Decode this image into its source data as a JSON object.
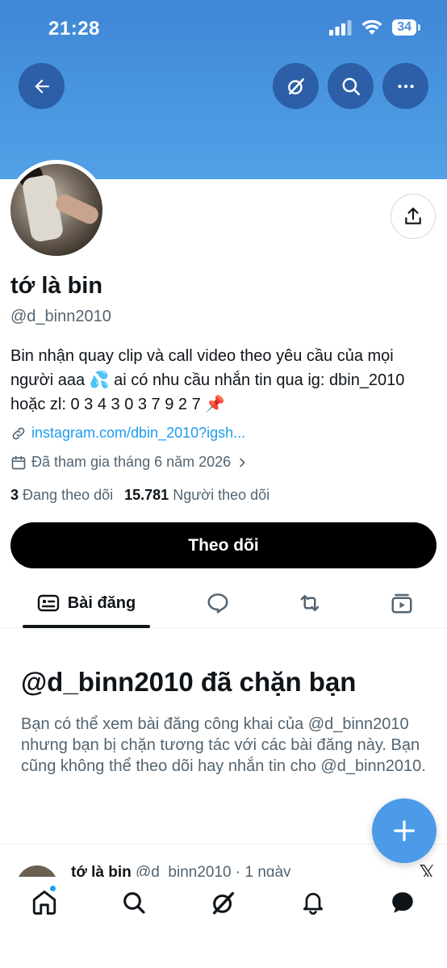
{
  "status_bar": {
    "time": "21:28",
    "battery": "34"
  },
  "profile": {
    "name": "tớ là bin",
    "handle": "@d_binn2010",
    "bio": "Bin nhận quay clip và call video theo yêu cầu của mọi người aaa 💦 ai có nhu cầu nhắn tin qua ig: dbin_2010 hoặc zl: 0 3 4 3 0 3 7 9 2 7 📌",
    "link": "instagram.com/dbin_2010?igsh...",
    "joined": "Đã tham gia tháng 6 năm 2026",
    "following_count": "3",
    "following_label": "Đang theo dõi",
    "followers_count": "15.781",
    "followers_label": "Người theo dõi"
  },
  "follow_button": "Theo dõi",
  "tabs": [
    {
      "label": "Bài đăng",
      "icon": "posts-icon",
      "active": true
    },
    {
      "label": "",
      "icon": "reply-icon",
      "active": false
    },
    {
      "label": "",
      "icon": "repost-icon",
      "active": false
    },
    {
      "label": "",
      "icon": "media-icon",
      "active": false
    }
  ],
  "blocked": {
    "title": "@d_binn2010 đã chặn bạn",
    "body": "Bạn có thể xem bài đăng công khai của @d_binn2010 nhưng bạn bị chặn tương tác với các bài đăng này. Bạn cũng không thể theo dõi hay nhắn tin cho @d_binn2010."
  },
  "peek_post": {
    "name": "tớ là bin",
    "meta": "@d_binn2010 · 1 ngày"
  },
  "colors": {
    "banner": "#4a97e0",
    "accent": "#1d9bf0",
    "fab": "#4b9be8",
    "text_primary": "#0f1419",
    "text_secondary": "#536471"
  },
  "bottom_nav": [
    "home-icon",
    "search-icon",
    "grok-icon",
    "notifications-icon",
    "messages-icon"
  ]
}
